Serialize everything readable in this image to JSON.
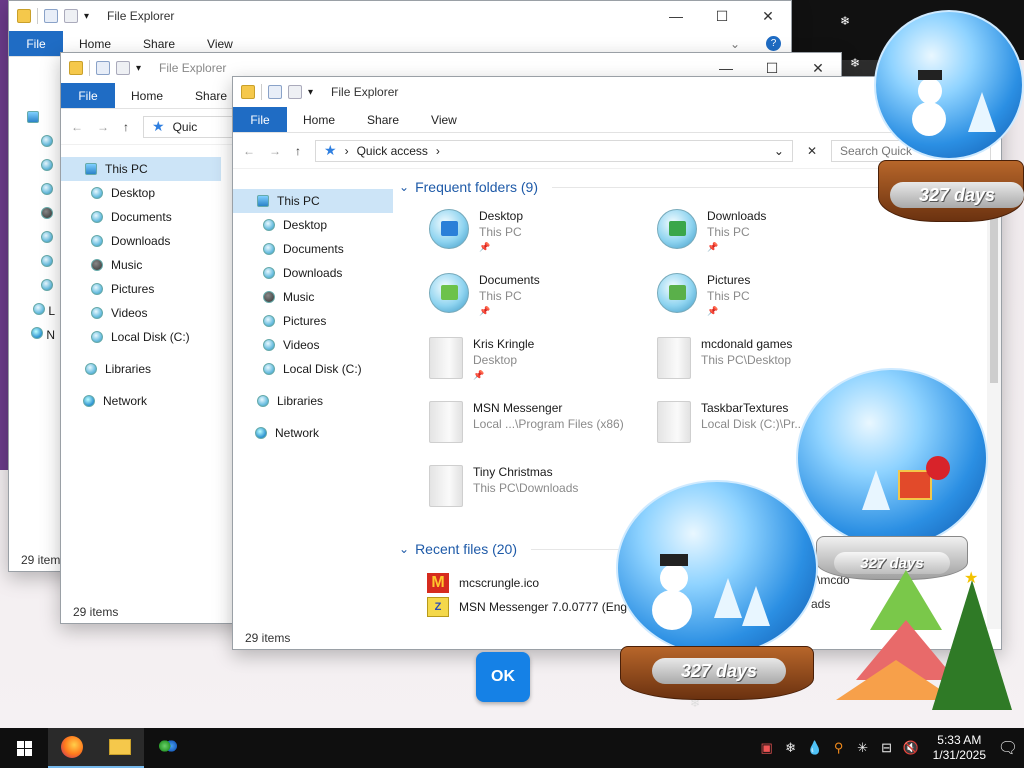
{
  "explorer": {
    "title": "File Explorer",
    "ribbon_tabs": [
      "File",
      "Home",
      "Share",
      "View"
    ],
    "address": "Quick access",
    "address_short": "Quic",
    "search_placeholder": "Search Quick",
    "nav": {
      "this_pc": "This PC",
      "items": [
        "Desktop",
        "Documents",
        "Downloads",
        "Music",
        "Pictures",
        "Videos",
        "Local Disk (C:)"
      ],
      "libraries": "Libraries",
      "network": "Network"
    },
    "status": "29 items",
    "frequent_header": "Frequent folders (9)",
    "recent_header": "Recent files (20)",
    "frequent": [
      {
        "name": "Desktop",
        "location": "This PC"
      },
      {
        "name": "Downloads",
        "location": "This PC"
      },
      {
        "name": "Documents",
        "location": "This PC"
      },
      {
        "name": "Pictures",
        "location": "This PC"
      },
      {
        "name": "Kris Kringle",
        "location": "Desktop"
      },
      {
        "name": "mcdonald games",
        "location": "This PC\\Desktop"
      },
      {
        "name": "MSN Messenger",
        "location": "Local ...\\Program Files (x86)"
      },
      {
        "name": "TaskbarTextures",
        "location": "Local Disk (C:)\\Pr..."
      },
      {
        "name": "Tiny Christmas",
        "location": "This PC\\Downloads"
      }
    ],
    "recent": [
      {
        "name": "mcscrungle.ico"
      },
      {
        "name": "MSN Messenger 7.0.0777 (Eng"
      }
    ],
    "recent_trailing": [
      "s\\mcdo",
      "ads"
    ],
    "back_status": [
      "29 item",
      "29",
      "29 items"
    ],
    "back_left_letters": [
      "L",
      "N"
    ]
  },
  "dialog": {
    "ok_label": "OK"
  },
  "globes": {
    "days_label": "327 days"
  },
  "taskbar": {
    "time": "5:33 AM",
    "date": "1/31/2025"
  },
  "colors": {
    "file_tab": "#1f6cc4",
    "section_header": "#1e5aa8",
    "ok_button": "#1581e6",
    "selected_nav": "#cce4f7"
  }
}
